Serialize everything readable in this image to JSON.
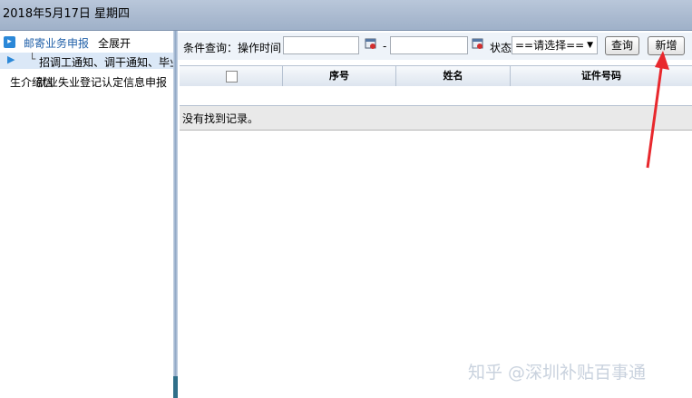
{
  "header": {
    "date": "2018年5月17日 星期四"
  },
  "sidebar": {
    "root_label": "邮寄业务申报",
    "expand_all": "全展开",
    "child_label": "招调工通知、调干通知、毕业",
    "child2_label": "生介绍信",
    "overlay_label": "就业失业登记认定信息申报"
  },
  "toolbar": {
    "query_label": "条件查询：操作时间",
    "start_value": "",
    "dash": "-",
    "end_value": "",
    "status_label": "状态",
    "status_selected": "==请选择==",
    "query_button": "查询",
    "add_button": "新增"
  },
  "grid": {
    "columns": [
      "序号",
      "姓名",
      "证件号码"
    ],
    "empty_message": "没有找到记录。"
  },
  "watermark": "知乎 @深圳补贴百事通",
  "colors": {
    "accent": "#2b88d8",
    "annotation_arrow": "#e8282d",
    "header_bg": "#a9b9cf"
  }
}
